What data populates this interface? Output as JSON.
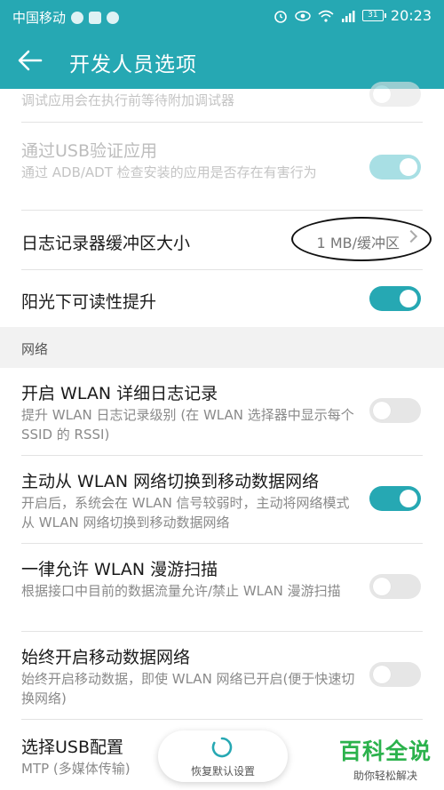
{
  "status_bar": {
    "carrier": "中国移动",
    "battery": "31",
    "time": "20:23"
  },
  "app_bar": {
    "title": "开发人员选项"
  },
  "items": [
    {
      "title": "",
      "subtitle": "调试应用会在执行前等待附加调试器",
      "toggle": "off",
      "disabled": true
    },
    {
      "title": "通过USB验证应用",
      "subtitle": "通过 ADB/ADT 检查安装的应用是否存在有害行为",
      "toggle": "on",
      "disabled": true
    },
    {
      "title": "日志记录器缓冲区大小",
      "value": "1 MB/缓冲区"
    },
    {
      "title": "阳光下可读性提升",
      "toggle": "on"
    }
  ],
  "section": {
    "title": "网络"
  },
  "network_items": [
    {
      "title": "开启 WLAN 详细日志记录",
      "subtitle": "提升 WLAN 日志记录级别 (在 WLAN 选择器中显示每个 SSID 的 RSSI)",
      "toggle": "off"
    },
    {
      "title": "主动从 WLAN 网络切换到移动数据网络",
      "subtitle": "开启后，系统会在 WLAN 信号较弱时，主动将网络模式从 WLAN 网络切换到移动数据网络",
      "toggle": "on"
    },
    {
      "title": "一律允许 WLAN 漫游扫描",
      "subtitle": "根据接口中目前的数据流量允许/禁止 WLAN 漫游扫描",
      "toggle": "off"
    },
    {
      "title": "始终开启移动数据网络",
      "subtitle": "始终开启移动数据，即使 WLAN 网络已开启(便于快速切换网络)",
      "toggle": "off"
    },
    {
      "title": "选择USB配置",
      "subtitle": "MTP (多媒体传输)"
    }
  ],
  "restore_button": {
    "label": "恢复默认设置"
  },
  "watermark": {
    "main": "百科全说",
    "sub": "助你轻松解决"
  },
  "colors": {
    "accent": "#26a8b3",
    "toggle_off": "#e6e6e6",
    "watermark": "#2bb24c"
  }
}
